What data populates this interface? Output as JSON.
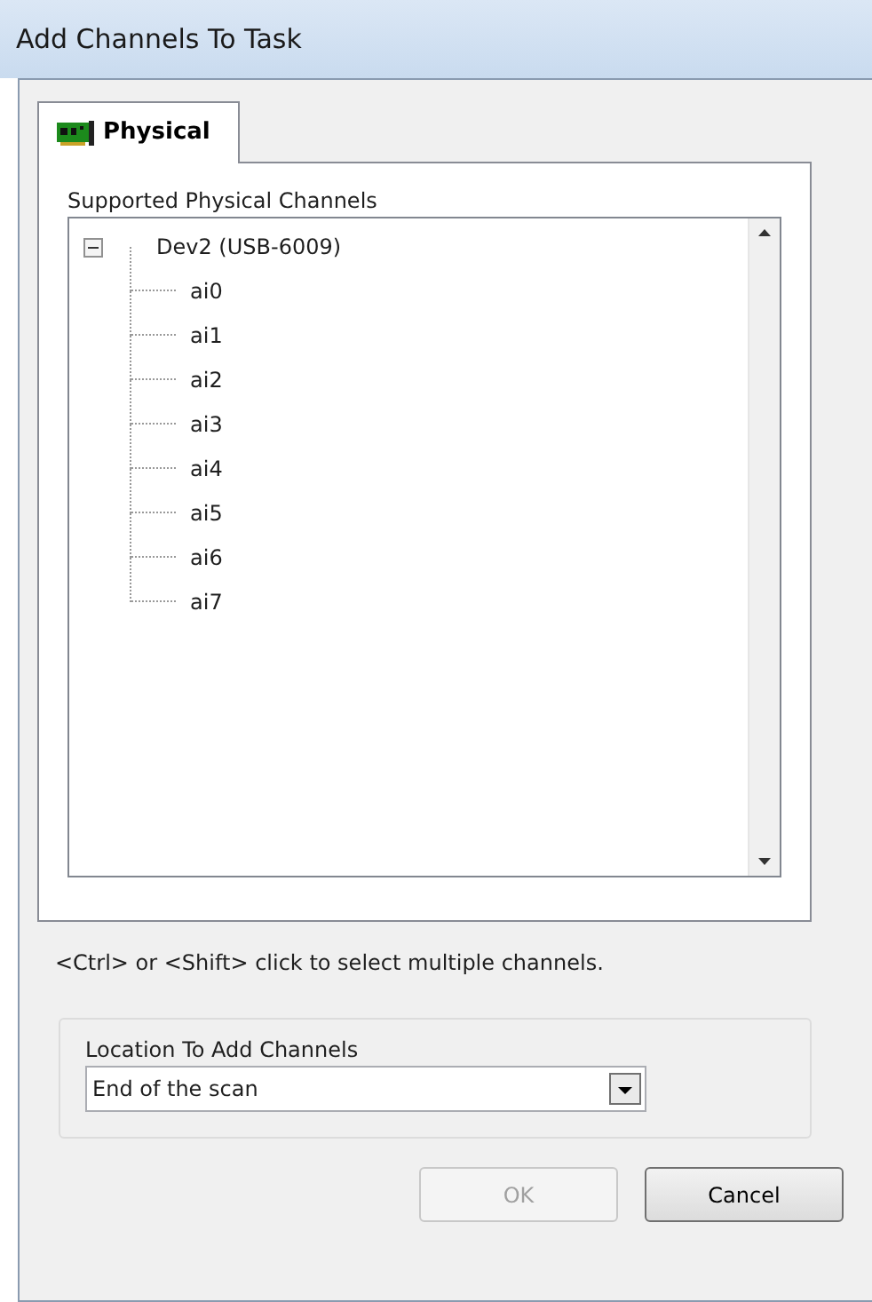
{
  "window": {
    "title": "Add Channels To Task"
  },
  "tabs": [
    {
      "label": "Physical",
      "selected": true
    }
  ],
  "channel_list": {
    "label": "Supported Physical Channels",
    "tree": [
      {
        "label": "Dev2  (USB-6009)",
        "expanded": true,
        "children": [
          {
            "label": "ai0",
            "selected": false
          },
          {
            "label": "ai1",
            "selected": false
          },
          {
            "label": "ai2",
            "selected": false
          },
          {
            "label": "ai3",
            "selected": false
          },
          {
            "label": "ai4",
            "selected": false
          },
          {
            "label": "ai5",
            "selected": false
          },
          {
            "label": "ai6",
            "selected": false
          },
          {
            "label": "ai7",
            "selected": false
          }
        ]
      }
    ]
  },
  "hint": "<Ctrl> or <Shift> click to select multiple channels.",
  "location": {
    "label": "Location To Add Channels",
    "value": "End of the scan"
  },
  "buttons": [
    {
      "label": "OK",
      "disabled": true
    },
    {
      "label": "Cancel",
      "disabled": false
    }
  ]
}
